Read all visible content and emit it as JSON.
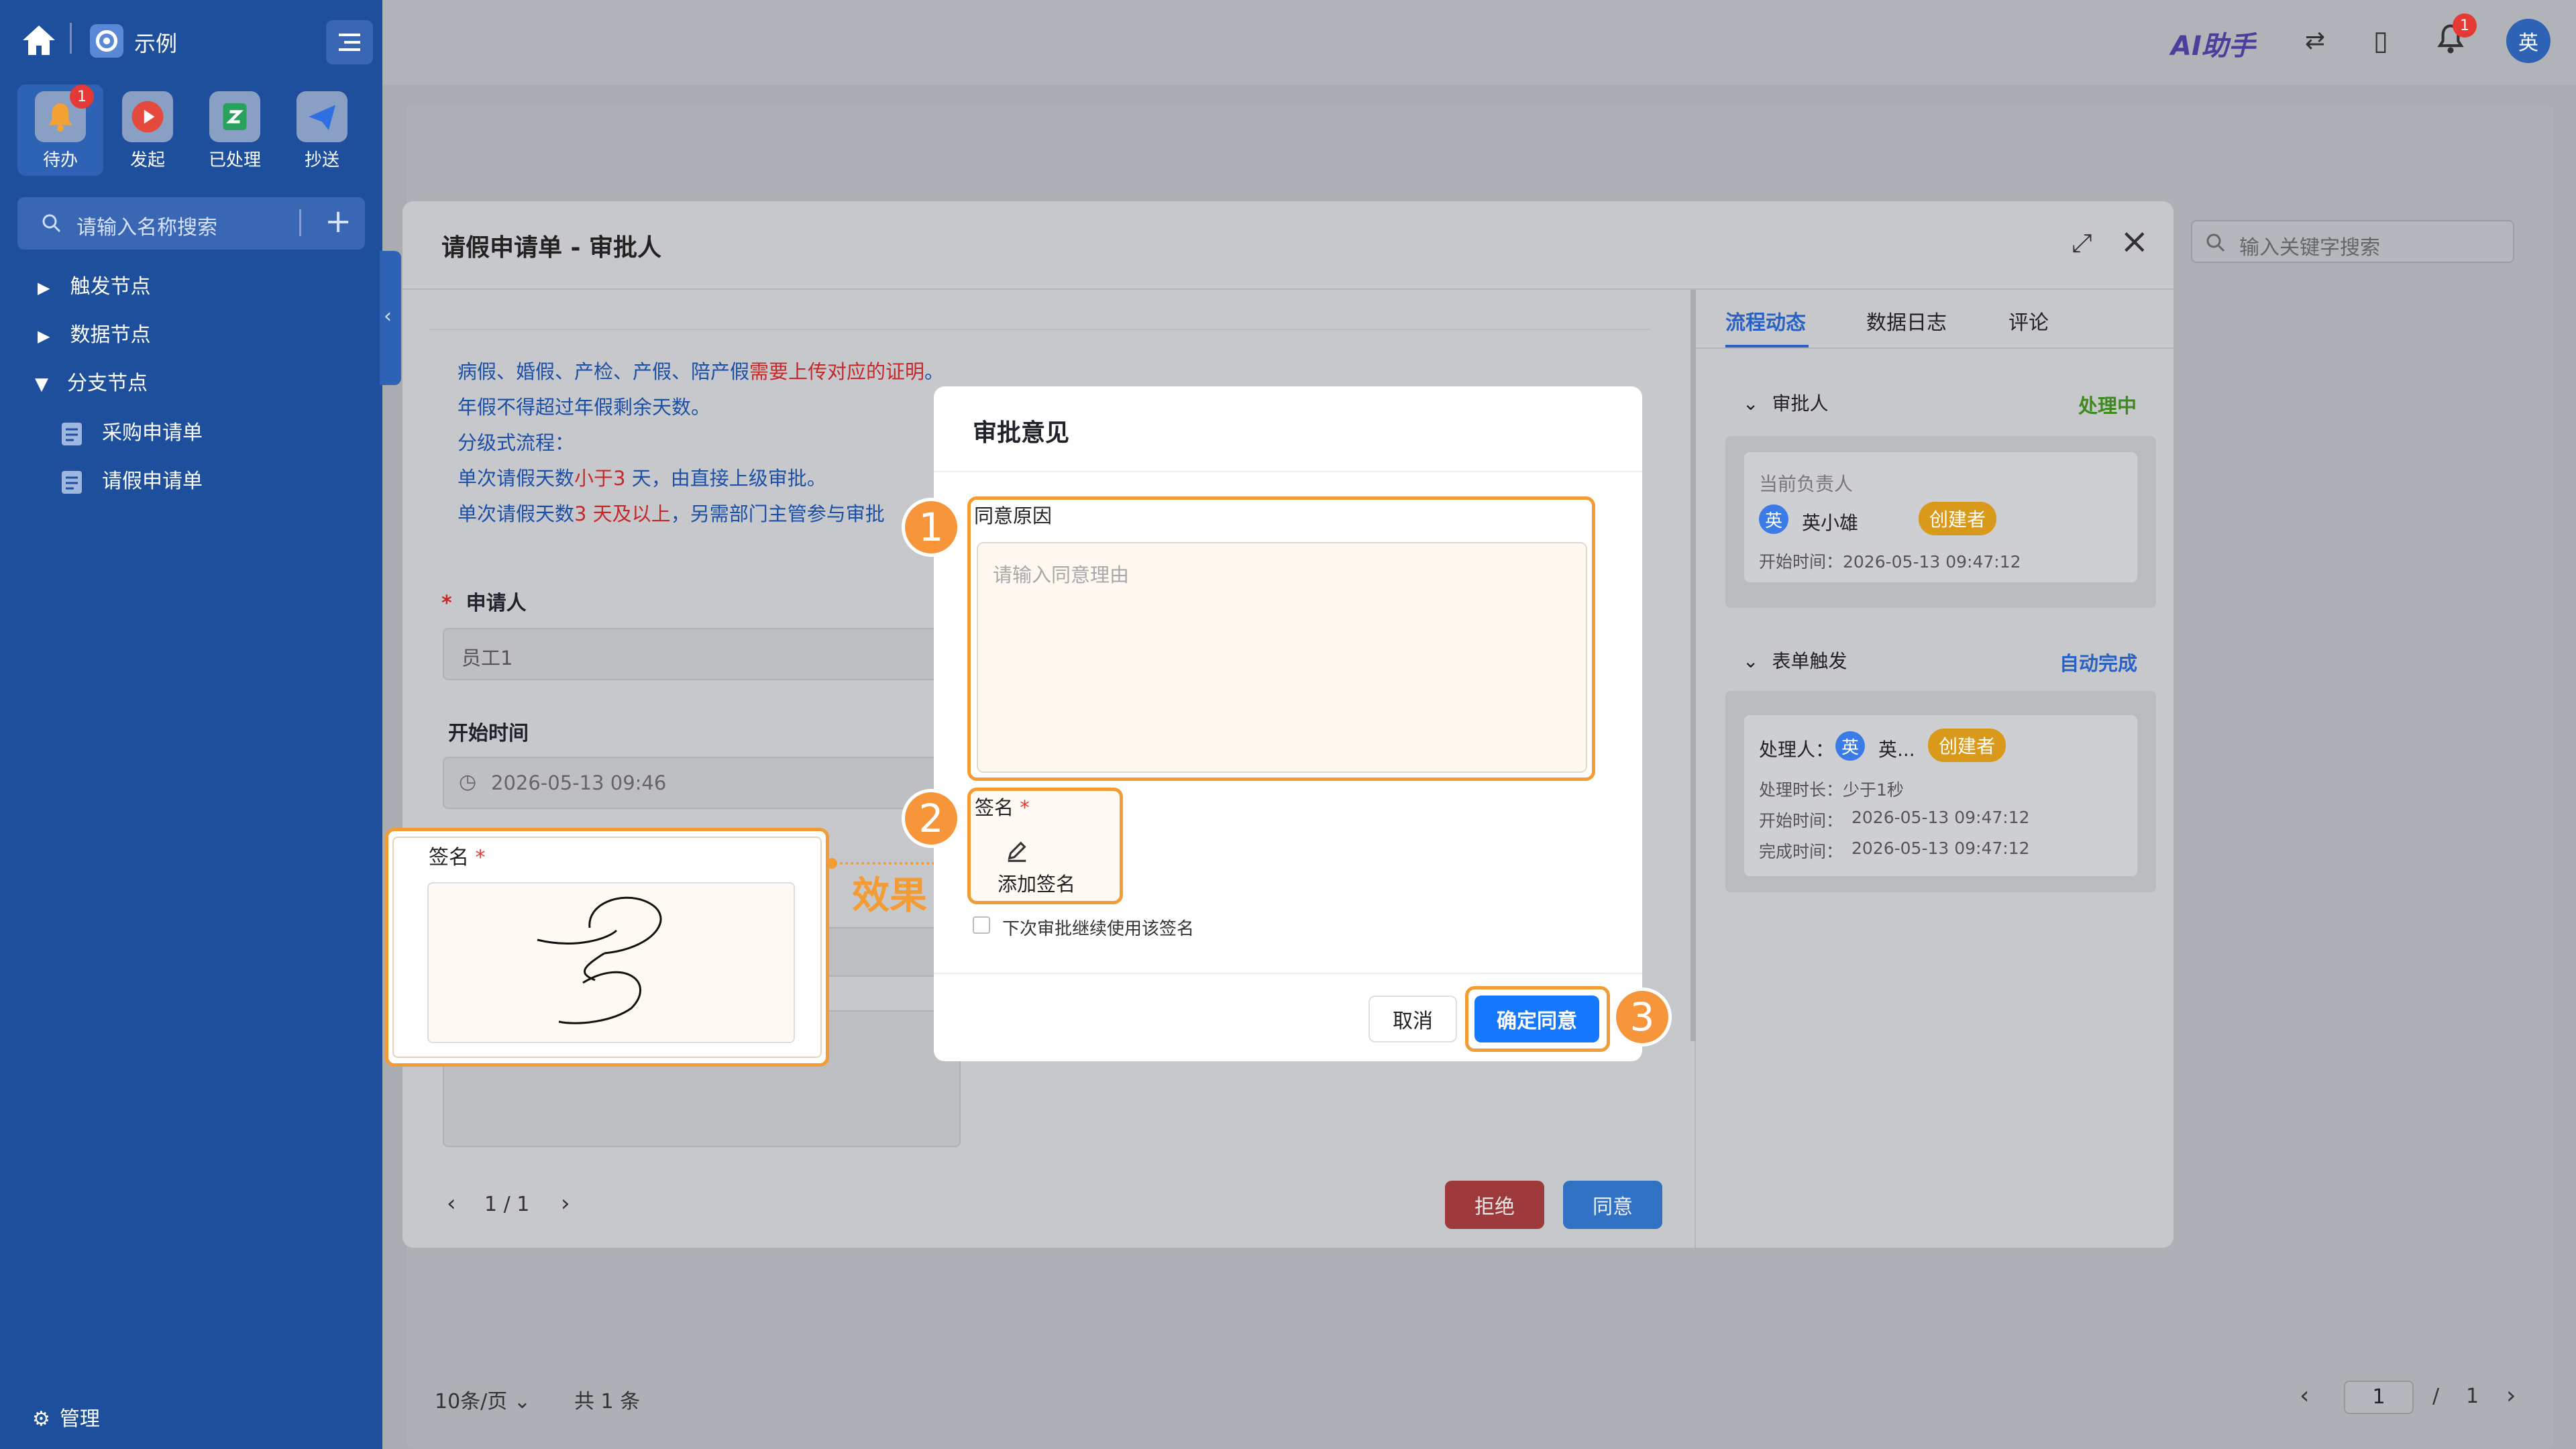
{
  "sidebar": {
    "app_name": "示例",
    "quick": [
      {
        "label": "待办",
        "badge": "1"
      },
      {
        "label": "发起"
      },
      {
        "label": "已处理"
      },
      {
        "label": "抄送"
      }
    ],
    "search_placeholder": "请输入名称搜索",
    "tree": [
      {
        "label": "触发节点"
      },
      {
        "label": "数据节点"
      },
      {
        "label": "分支节点"
      }
    ],
    "children": [
      {
        "label": "采购申请单"
      },
      {
        "label": "请假申请单"
      }
    ],
    "manage": "管理"
  },
  "header": {
    "ai": "AI助手",
    "bell_badge": "1",
    "avatar": "英"
  },
  "bg": {
    "search_placeholder": "输入关键字搜索",
    "page_size": "10条/页",
    "total": "共 1 条",
    "page": "1",
    "pages": "1"
  },
  "form_modal": {
    "title": "请假申请单 - 审批人",
    "notice": {
      "l1a": "病假、婚假、产检、产假、陪产假",
      "l1b": "需要上传对应的证明",
      "l1c": "。",
      "l2": "年假不得超过年假剩余天数。",
      "l3": "分级式流程：",
      "l4a": "单次请假天数",
      "l4b": "小于",
      "l4c": "3",
      "l4d": " 天，由直接上级审批。",
      "l5a": "单次请假天数",
      "l5b": "3",
      "l5c": " 天及以上",
      "l5d": "，另需部门主管参与审批"
    },
    "applicant_label": "申请人",
    "applicant_value": "员工1",
    "start_label": "开始时间",
    "start_value": "2026-05-13 09:46",
    "pager": "1 / 1",
    "reject": "拒绝",
    "approve": "同意"
  },
  "right_panel": {
    "tabs": [
      "流程动态",
      "数据日志",
      "评论"
    ],
    "node1": {
      "title": "审批人",
      "status": "处理中",
      "owner_label": "当前负责人",
      "avatar": "英",
      "name": "英小雄",
      "chip": "创建者",
      "start": "开始时间：2026-05-13 09:47:12"
    },
    "node2": {
      "title": "表单触发",
      "status": "自动完成",
      "handler_label": "处理人：",
      "avatar": "英",
      "name": "英...",
      "chip": "创建者",
      "duration": "处理时长：少于1秒",
      "start_label": "开始时间：",
      "start": "2026-05-13 09:47:12",
      "end_label": "完成时间：",
      "end": "2026-05-13 09:47:12"
    }
  },
  "dialog": {
    "title": "审批意见",
    "reason_label": "同意原因",
    "reason_placeholder": "请输入同意理由",
    "sign_label": "签名",
    "add_sign": "添加签名",
    "reuse": "下次审批继续使用该签名",
    "cancel": "取消",
    "confirm": "确定同意"
  },
  "callout": {
    "sign_label": "签名",
    "effect": "效果",
    "n1": "1",
    "n2": "2",
    "n3": "3"
  },
  "colors": {
    "sidebar": "#1d4f9c",
    "primary": "#1677ff",
    "danger": "#d93a3a",
    "highlight": "#f39b34",
    "green": "#52a829"
  }
}
